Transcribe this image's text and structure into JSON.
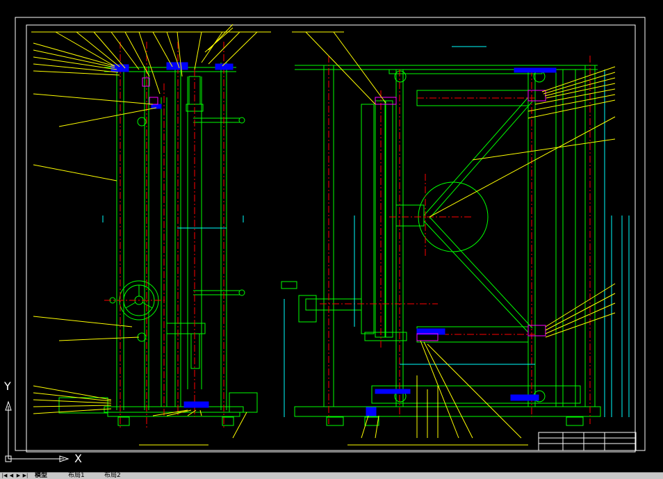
{
  "ucs": {
    "x_label": "X",
    "y_label": "Y"
  },
  "layout_tabs": [
    {
      "label": "模型",
      "active": true
    },
    {
      "label": "布局1",
      "active": false
    },
    {
      "label": "布局2",
      "active": false
    }
  ],
  "colors": {
    "background": "#000000",
    "border": "#ffffff",
    "part": "#00ff00",
    "centerline": "#ff0000",
    "leader": "#ffff00",
    "hatch": "#0000ff",
    "accent": "#ff00ff",
    "dimension": "#00ffff"
  }
}
